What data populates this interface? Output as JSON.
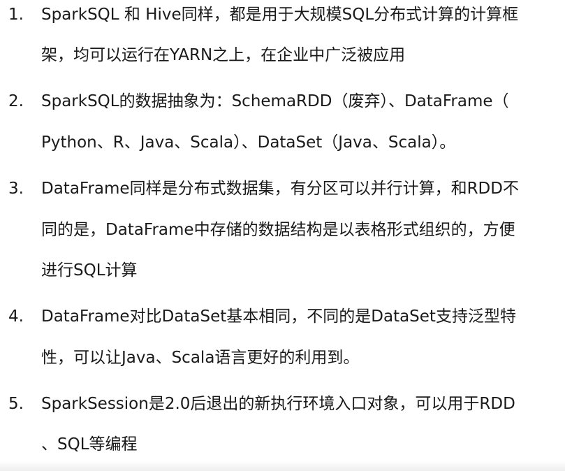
{
  "items": [
    {
      "number": "1.",
      "lines": [
        "SparkSQL 和 Hive同样，都是用于大规模SQL分布式计算的计算框",
        "架，均可以运行在YARN之上，在企业中广泛被应用"
      ]
    },
    {
      "number": "2.",
      "lines": [
        "SparkSQL的数据抽象为：SchemaRDD（废弃）、DataFrame（",
        "Python、R、Java、Scala）、DataSet（Java、Scala）。"
      ]
    },
    {
      "number": "3.",
      "lines": [
        "DataFrame同样是分布式数据集，有分区可以并行计算，和RDD不",
        "同的是，DataFrame中存储的数据结构是以表格形式组织的，方便",
        "进行SQL计算"
      ]
    },
    {
      "number": "4.",
      "lines": [
        "DataFrame对比DataSet基本相同，不同的是DataSet支持泛型特",
        "性，可以让Java、Scala语言更好的利用到。"
      ]
    },
    {
      "number": "5.",
      "lines": [
        "SparkSession是2.0后退出的新执行环境入口对象，可以用于RDD",
        "、SQL等编程"
      ]
    }
  ]
}
